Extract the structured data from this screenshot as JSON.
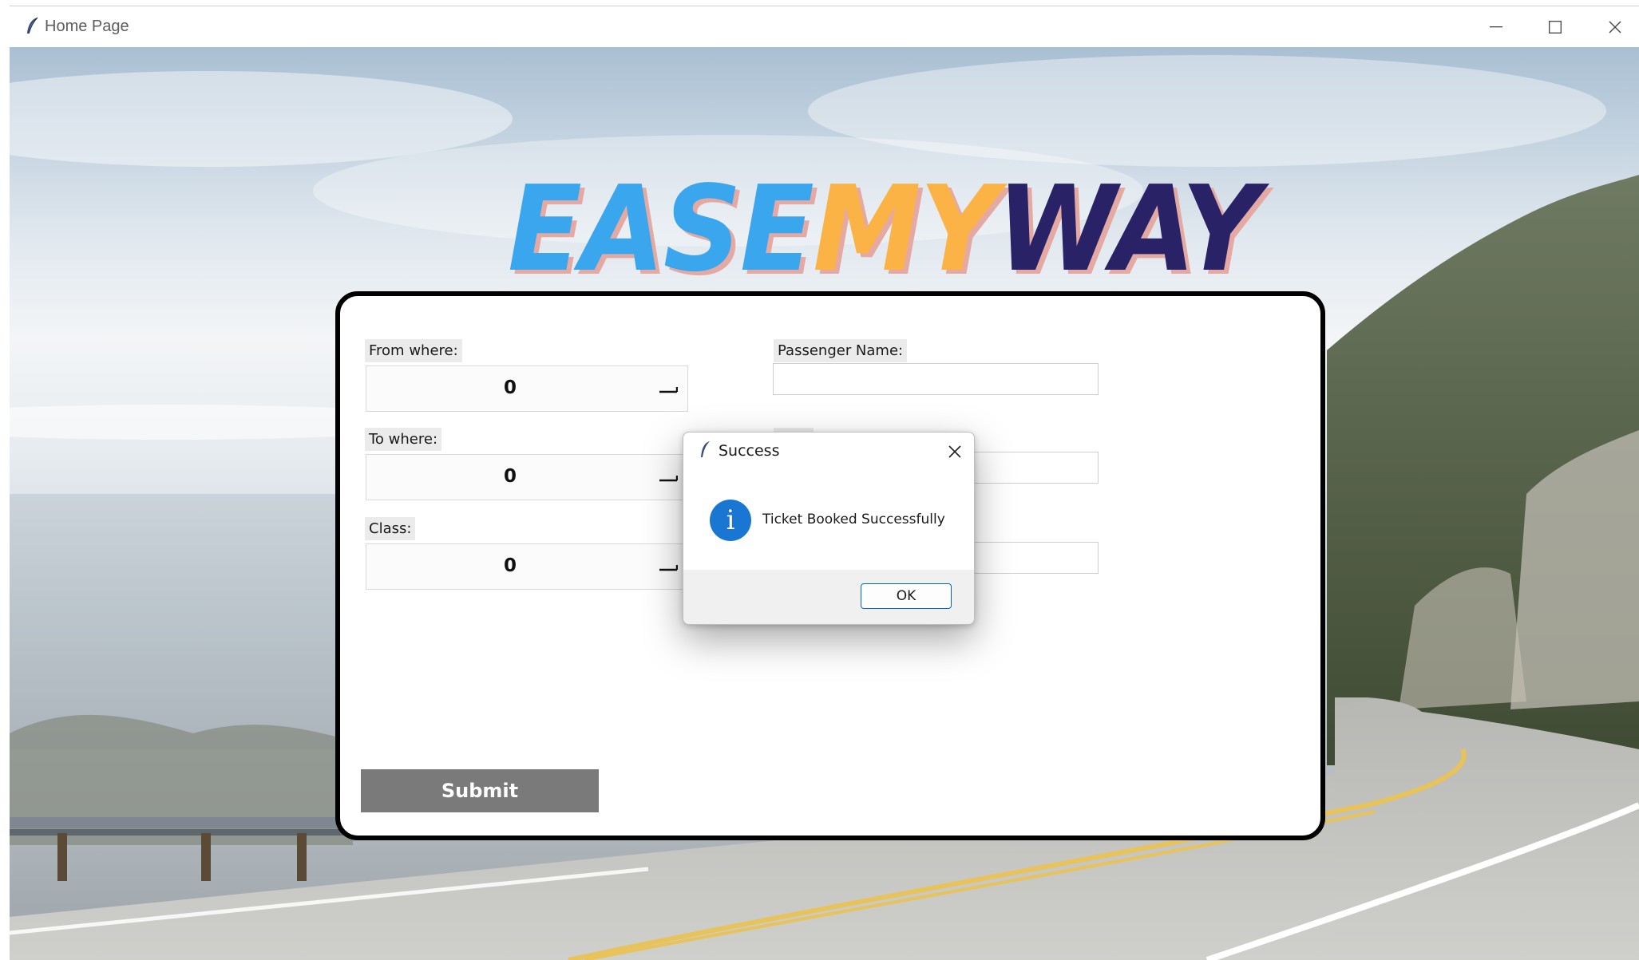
{
  "window": {
    "title": "Home Page",
    "controls": [
      "minimize",
      "maximize",
      "close"
    ]
  },
  "logo": {
    "part1": "EASE",
    "part2": "MY",
    "part3": "WAY",
    "colors": {
      "ease": "#3aa6ee",
      "my": "#fbb346",
      "way": "#2a2266"
    }
  },
  "form": {
    "from_label": "From where:",
    "from_value": "0",
    "to_label": "To where:",
    "to_value": "0",
    "class_label": "Class:",
    "class_value": "0",
    "passenger_label": "Passenger Name:",
    "passenger_value": "",
    "field2_value": "",
    "field3_value": "",
    "submit_label": "Submit"
  },
  "dialog": {
    "title": "Success",
    "icon": "info-icon",
    "message": "Ticket Booked Successfully",
    "ok_label": "OK",
    "accent_color": "#0067c0"
  }
}
